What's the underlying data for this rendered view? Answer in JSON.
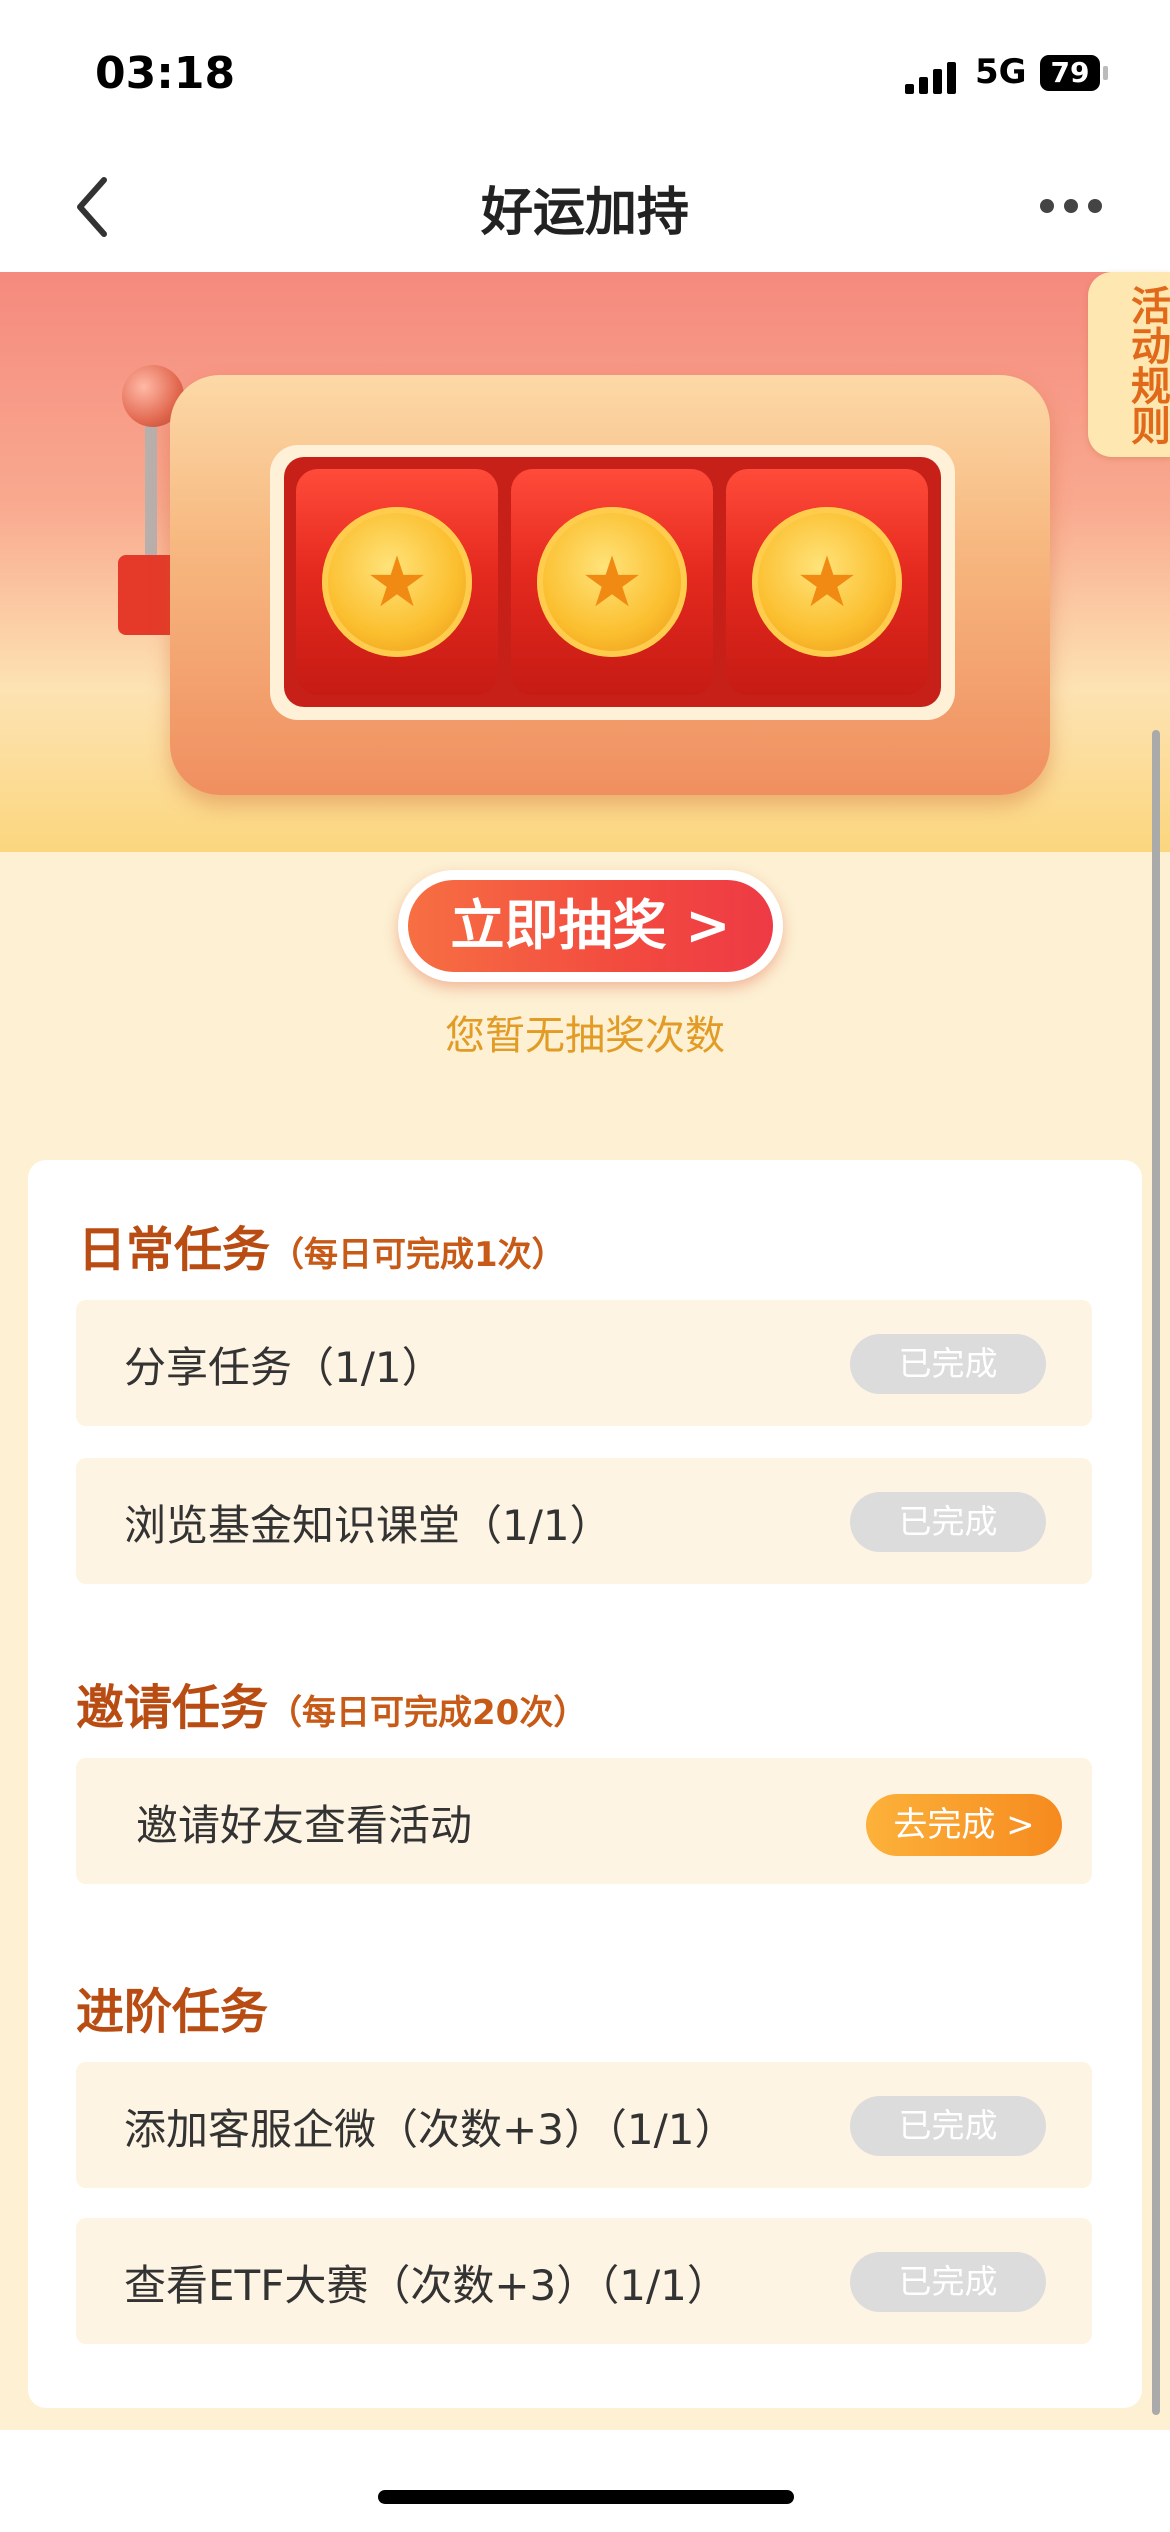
{
  "status_bar": {
    "time": "03:18",
    "network": "5G",
    "battery": "79"
  },
  "nav": {
    "title": "好运加持",
    "back_icon": "chevron-left-icon",
    "more_icon": "more-dots-icon"
  },
  "hero": {
    "rules_tab": "活动规则",
    "reel_symbol": "★",
    "draw_button": "立即抽奖 >",
    "no_chances_text": "您暂无抽奖次数"
  },
  "sections": {
    "daily": {
      "title": "日常任务",
      "subtitle": "（每日可完成1次）",
      "tasks": [
        {
          "label": "分享任务（1/1）",
          "status": "已完成"
        },
        {
          "label": "浏览基金知识课堂（1/1）",
          "status": "已完成"
        }
      ]
    },
    "invite": {
      "title": "邀请任务",
      "subtitle": "（每日可完成20次）",
      "tasks": [
        {
          "label": "邀请好友查看活动",
          "action": "去完成 >"
        }
      ]
    },
    "advanced": {
      "title": "进阶任务",
      "tasks": [
        {
          "label": "添加客服企微（次数+3）（1/1）",
          "status": "已完成"
        },
        {
          "label": "查看ETF大赛（次数+3）（1/1）",
          "status": "已完成"
        }
      ]
    }
  },
  "colors": {
    "accent": "#b84c12",
    "button_red": "#f24a3f",
    "go_orange": "#f68a1f",
    "done_grey": "#dcdcdc"
  }
}
